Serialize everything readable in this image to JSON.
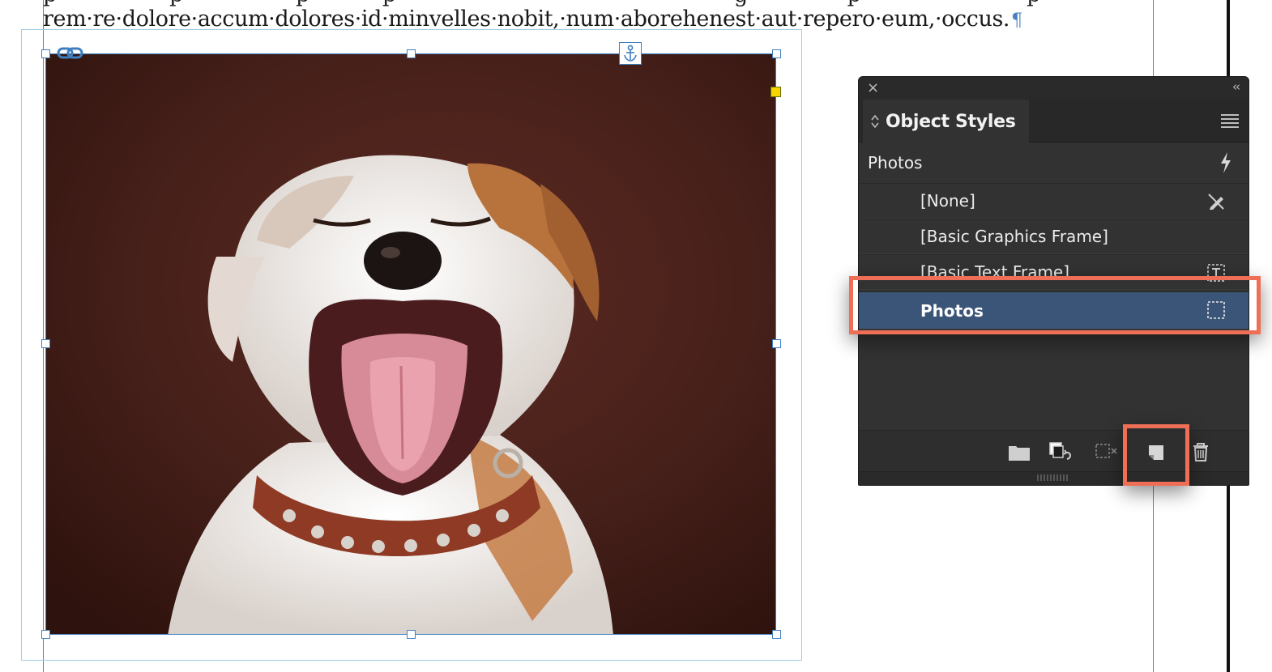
{
  "document": {
    "prev_line_fragment": "p · · · · · · · · p · · · · · · · · p · · · · · p · · · · · · · · · · · · · · · · · · · · · · · · · g · · · · · · · p · · · · · · · · · · · · p",
    "body_line": "rem·re·dolore·accum·dolores·id·minvelles·nobit,·num·aborehenest·aut·repero·eum,·occus.",
    "pilcrow": "¶",
    "photo_alt": "Jack Russell terrier yawning against a brown backdrop"
  },
  "panel": {
    "close_glyph": "×",
    "collapse_glyph": "‹‹",
    "tab_label": "Object Styles",
    "group_label": "Photos",
    "items": [
      {
        "label": "[None]",
        "icon": "clear-pen-icon"
      },
      {
        "label": "[Basic Graphics Frame]",
        "icon": ""
      },
      {
        "label": "[Basic Text Frame]",
        "icon": "text-frame-icon"
      },
      {
        "label": "Photos",
        "icon": "graphic-frame-icon",
        "selected": true
      }
    ],
    "footer_buttons": [
      "new-group-folder-icon",
      "clear-overrides-icon",
      "clear-attributes-icon",
      "create-new-style-icon",
      "trash-icon"
    ]
  },
  "colors": {
    "selection_row": "#3b5578",
    "callout": "#ee6f55",
    "frame_edge": "#3f7fc0",
    "guide": "#b84fc2"
  }
}
